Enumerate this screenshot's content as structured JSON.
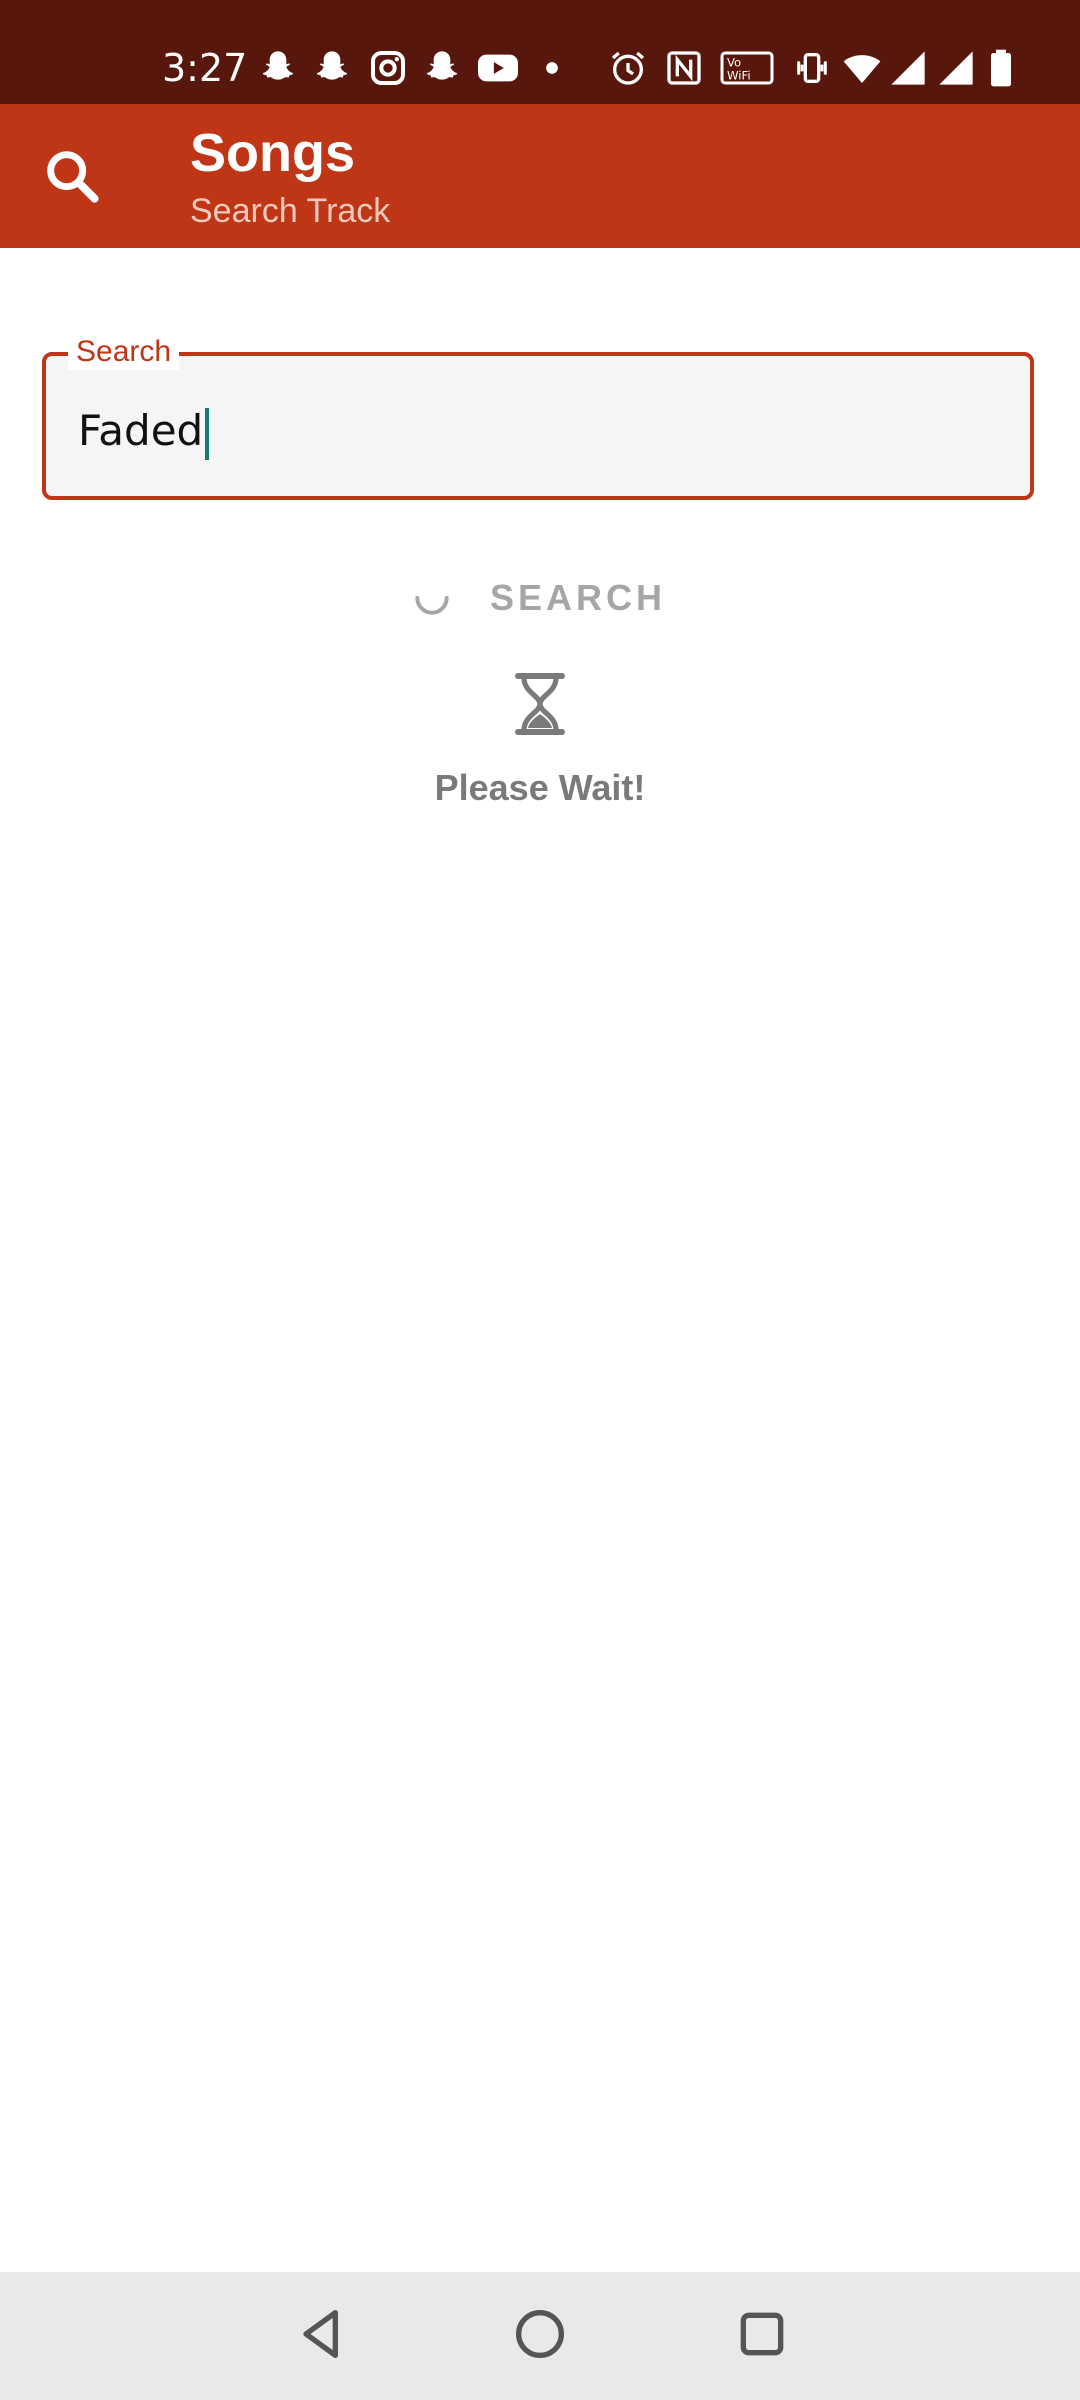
{
  "status_bar": {
    "time": "3:27",
    "icons": [
      "snapchat-icon",
      "snapchat-icon",
      "instagram-icon",
      "snapchat-icon",
      "youtube-icon",
      "dot-icon",
      "alarm-icon",
      "nfc-icon",
      "vowifi-icon",
      "vibrate-icon",
      "wifi-icon",
      "signal-icon",
      "signal-icon",
      "battery-icon"
    ]
  },
  "app_bar": {
    "title": "Songs",
    "subtitle": "Search Track",
    "color": "#bf3616"
  },
  "search": {
    "label": "Search",
    "value": "Faded"
  },
  "search_button": {
    "label": "SEARCH"
  },
  "status": {
    "wait_text": "Please Wait!"
  },
  "nav": {
    "back": "back-icon",
    "home": "home-icon",
    "recents": "recents-icon"
  }
}
